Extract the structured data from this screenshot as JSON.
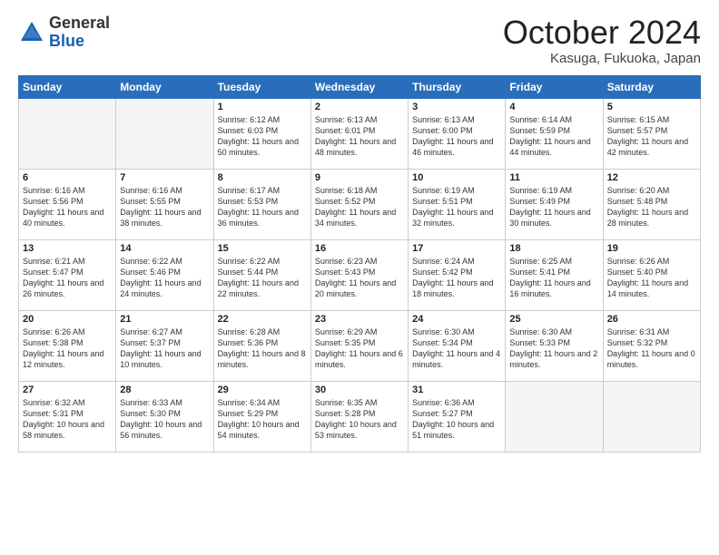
{
  "header": {
    "logo_general": "General",
    "logo_blue": "Blue",
    "month_title": "October 2024",
    "location": "Kasuga, Fukuoka, Japan"
  },
  "weekdays": [
    "Sunday",
    "Monday",
    "Tuesday",
    "Wednesday",
    "Thursday",
    "Friday",
    "Saturday"
  ],
  "weeks": [
    [
      {
        "day": "",
        "sunrise": "",
        "sunset": "",
        "daylight": ""
      },
      {
        "day": "",
        "sunrise": "",
        "sunset": "",
        "daylight": ""
      },
      {
        "day": "1",
        "sunrise": "Sunrise: 6:12 AM",
        "sunset": "Sunset: 6:03 PM",
        "daylight": "Daylight: 11 hours and 50 minutes."
      },
      {
        "day": "2",
        "sunrise": "Sunrise: 6:13 AM",
        "sunset": "Sunset: 6:01 PM",
        "daylight": "Daylight: 11 hours and 48 minutes."
      },
      {
        "day": "3",
        "sunrise": "Sunrise: 6:13 AM",
        "sunset": "Sunset: 6:00 PM",
        "daylight": "Daylight: 11 hours and 46 minutes."
      },
      {
        "day": "4",
        "sunrise": "Sunrise: 6:14 AM",
        "sunset": "Sunset: 5:59 PM",
        "daylight": "Daylight: 11 hours and 44 minutes."
      },
      {
        "day": "5",
        "sunrise": "Sunrise: 6:15 AM",
        "sunset": "Sunset: 5:57 PM",
        "daylight": "Daylight: 11 hours and 42 minutes."
      }
    ],
    [
      {
        "day": "6",
        "sunrise": "Sunrise: 6:16 AM",
        "sunset": "Sunset: 5:56 PM",
        "daylight": "Daylight: 11 hours and 40 minutes."
      },
      {
        "day": "7",
        "sunrise": "Sunrise: 6:16 AM",
        "sunset": "Sunset: 5:55 PM",
        "daylight": "Daylight: 11 hours and 38 minutes."
      },
      {
        "day": "8",
        "sunrise": "Sunrise: 6:17 AM",
        "sunset": "Sunset: 5:53 PM",
        "daylight": "Daylight: 11 hours and 36 minutes."
      },
      {
        "day": "9",
        "sunrise": "Sunrise: 6:18 AM",
        "sunset": "Sunset: 5:52 PM",
        "daylight": "Daylight: 11 hours and 34 minutes."
      },
      {
        "day": "10",
        "sunrise": "Sunrise: 6:19 AM",
        "sunset": "Sunset: 5:51 PM",
        "daylight": "Daylight: 11 hours and 32 minutes."
      },
      {
        "day": "11",
        "sunrise": "Sunrise: 6:19 AM",
        "sunset": "Sunset: 5:49 PM",
        "daylight": "Daylight: 11 hours and 30 minutes."
      },
      {
        "day": "12",
        "sunrise": "Sunrise: 6:20 AM",
        "sunset": "Sunset: 5:48 PM",
        "daylight": "Daylight: 11 hours and 28 minutes."
      }
    ],
    [
      {
        "day": "13",
        "sunrise": "Sunrise: 6:21 AM",
        "sunset": "Sunset: 5:47 PM",
        "daylight": "Daylight: 11 hours and 26 minutes."
      },
      {
        "day": "14",
        "sunrise": "Sunrise: 6:22 AM",
        "sunset": "Sunset: 5:46 PM",
        "daylight": "Daylight: 11 hours and 24 minutes."
      },
      {
        "day": "15",
        "sunrise": "Sunrise: 6:22 AM",
        "sunset": "Sunset: 5:44 PM",
        "daylight": "Daylight: 11 hours and 22 minutes."
      },
      {
        "day": "16",
        "sunrise": "Sunrise: 6:23 AM",
        "sunset": "Sunset: 5:43 PM",
        "daylight": "Daylight: 11 hours and 20 minutes."
      },
      {
        "day": "17",
        "sunrise": "Sunrise: 6:24 AM",
        "sunset": "Sunset: 5:42 PM",
        "daylight": "Daylight: 11 hours and 18 minutes."
      },
      {
        "day": "18",
        "sunrise": "Sunrise: 6:25 AM",
        "sunset": "Sunset: 5:41 PM",
        "daylight": "Daylight: 11 hours and 16 minutes."
      },
      {
        "day": "19",
        "sunrise": "Sunrise: 6:26 AM",
        "sunset": "Sunset: 5:40 PM",
        "daylight": "Daylight: 11 hours and 14 minutes."
      }
    ],
    [
      {
        "day": "20",
        "sunrise": "Sunrise: 6:26 AM",
        "sunset": "Sunset: 5:38 PM",
        "daylight": "Daylight: 11 hours and 12 minutes."
      },
      {
        "day": "21",
        "sunrise": "Sunrise: 6:27 AM",
        "sunset": "Sunset: 5:37 PM",
        "daylight": "Daylight: 11 hours and 10 minutes."
      },
      {
        "day": "22",
        "sunrise": "Sunrise: 6:28 AM",
        "sunset": "Sunset: 5:36 PM",
        "daylight": "Daylight: 11 hours and 8 minutes."
      },
      {
        "day": "23",
        "sunrise": "Sunrise: 6:29 AM",
        "sunset": "Sunset: 5:35 PM",
        "daylight": "Daylight: 11 hours and 6 minutes."
      },
      {
        "day": "24",
        "sunrise": "Sunrise: 6:30 AM",
        "sunset": "Sunset: 5:34 PM",
        "daylight": "Daylight: 11 hours and 4 minutes."
      },
      {
        "day": "25",
        "sunrise": "Sunrise: 6:30 AM",
        "sunset": "Sunset: 5:33 PM",
        "daylight": "Daylight: 11 hours and 2 minutes."
      },
      {
        "day": "26",
        "sunrise": "Sunrise: 6:31 AM",
        "sunset": "Sunset: 5:32 PM",
        "daylight": "Daylight: 11 hours and 0 minutes."
      }
    ],
    [
      {
        "day": "27",
        "sunrise": "Sunrise: 6:32 AM",
        "sunset": "Sunset: 5:31 PM",
        "daylight": "Daylight: 10 hours and 58 minutes."
      },
      {
        "day": "28",
        "sunrise": "Sunrise: 6:33 AM",
        "sunset": "Sunset: 5:30 PM",
        "daylight": "Daylight: 10 hours and 56 minutes."
      },
      {
        "day": "29",
        "sunrise": "Sunrise: 6:34 AM",
        "sunset": "Sunset: 5:29 PM",
        "daylight": "Daylight: 10 hours and 54 minutes."
      },
      {
        "day": "30",
        "sunrise": "Sunrise: 6:35 AM",
        "sunset": "Sunset: 5:28 PM",
        "daylight": "Daylight: 10 hours and 53 minutes."
      },
      {
        "day": "31",
        "sunrise": "Sunrise: 6:36 AM",
        "sunset": "Sunset: 5:27 PM",
        "daylight": "Daylight: 10 hours and 51 minutes."
      },
      {
        "day": "",
        "sunrise": "",
        "sunset": "",
        "daylight": ""
      },
      {
        "day": "",
        "sunrise": "",
        "sunset": "",
        "daylight": ""
      }
    ]
  ]
}
